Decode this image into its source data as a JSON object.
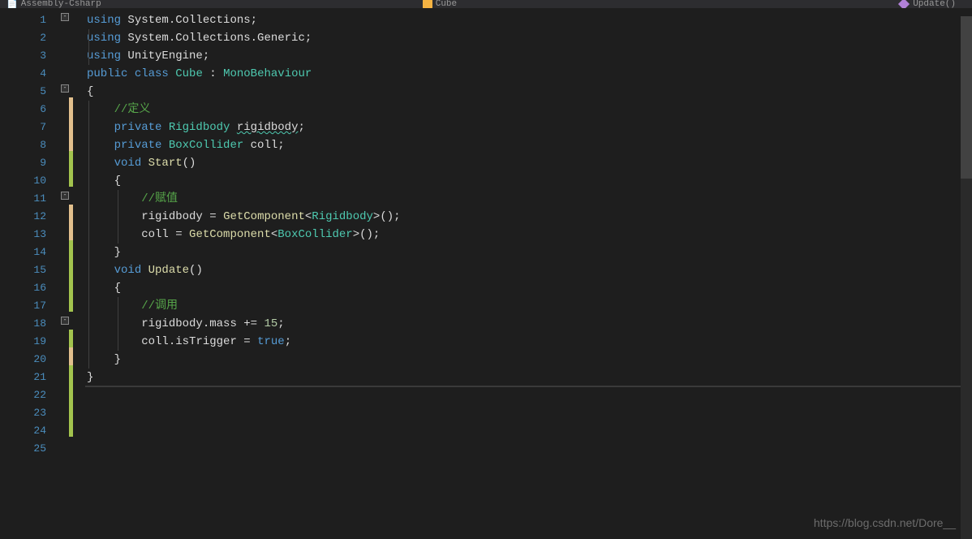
{
  "nav": {
    "project": "Assembly-Csharp",
    "class": "Cube",
    "method": "Update()"
  },
  "lines": [
    {
      "n": "1"
    },
    {
      "n": "2"
    },
    {
      "n": "3"
    },
    {
      "n": "4"
    },
    {
      "n": "5"
    },
    {
      "n": "6"
    },
    {
      "n": "7"
    },
    {
      "n": "8"
    },
    {
      "n": "9"
    },
    {
      "n": "10"
    },
    {
      "n": "11"
    },
    {
      "n": "12"
    },
    {
      "n": "13"
    },
    {
      "n": "14"
    },
    {
      "n": "15"
    },
    {
      "n": "16"
    },
    {
      "n": "17"
    },
    {
      "n": "18"
    },
    {
      "n": "19"
    },
    {
      "n": "20"
    },
    {
      "n": "21"
    },
    {
      "n": "22"
    },
    {
      "n": "23"
    },
    {
      "n": "24"
    },
    {
      "n": "25"
    }
  ],
  "code": {
    "l1_using": "using",
    "l1_ns": "System.Collections",
    "l2_using": "using",
    "l2_ns": "System.Collections.Generic",
    "l3_using": "using",
    "l3_ns": "UnityEngine",
    "l5_public": "public",
    "l5_class": "class",
    "l5_name": "Cube",
    "l5_mono": "MonoBehaviour",
    "l6_brace": "{",
    "l7_comment": "//定义",
    "l8_private": "private",
    "l8_type": "Rigidbody",
    "l8_field": "rigidbody",
    "l9_private": "private",
    "l9_type": "BoxCollider",
    "l9_field": "coll",
    "l11_void": "void",
    "l11_name": "Start",
    "l12_brace": "{",
    "l13_comment": "//赋值",
    "l14_field": "rigidbody",
    "l14_get": "GetComponent",
    "l14_type": "Rigidbody",
    "l15_field": "coll",
    "l15_get": "GetComponent",
    "l15_type": "BoxCollider",
    "l16_brace": "}",
    "l18_void": "void",
    "l18_name": "Update",
    "l19_brace": "{",
    "l20_comment": "//调用",
    "l21_field": "rigidbody",
    "l21_prop": "mass",
    "l21_val": "15",
    "l22_field": "coll",
    "l22_prop": "isTrigger",
    "l22_val": "true",
    "l23_brace": "}",
    "l24_brace": "}"
  },
  "watermark": "https://blog.csdn.net/Dore__"
}
